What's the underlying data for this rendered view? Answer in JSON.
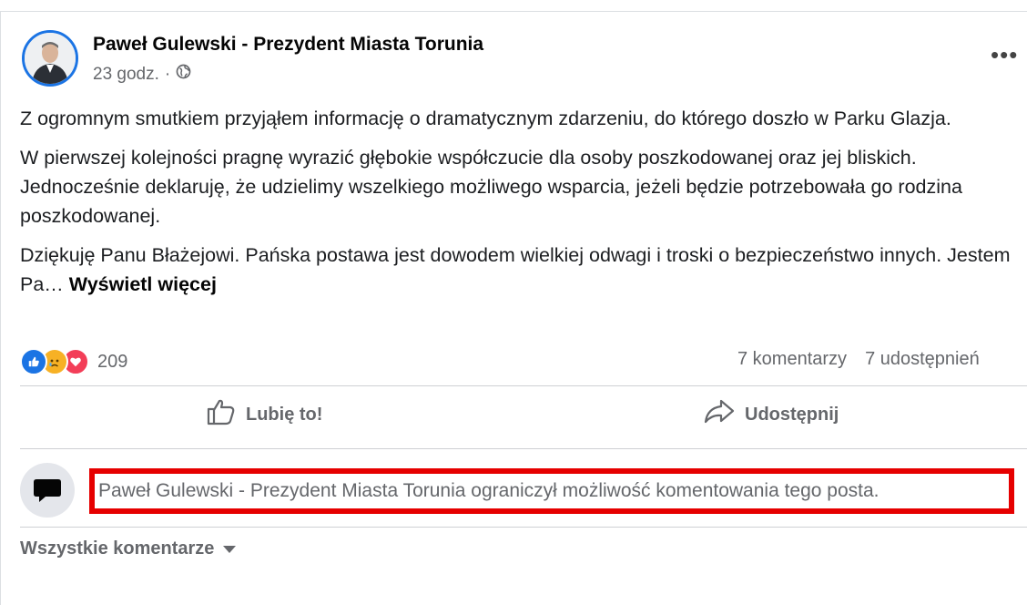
{
  "post": {
    "author": "Paweł Gulewski - Prezydent Miasta Torunia",
    "time": "23 godz.",
    "separator": "·",
    "paragraphs": [
      "Z ogromnym smutkiem przyjąłem informację o dramatycznym zdarzeniu, do którego doszło w Parku Glazja.",
      "W pierwszej kolejności pragnę wyrazić głębokie współczucie dla osoby poszkodowanej oraz jej bliskich. Jednocześnie deklaruję, że udzielimy wszelkiego możliwego wsparcia, jeżeli będzie potrzebowała go rodzina poszkodowanej.",
      "Dziękuję Panu Błażejowi. Pańska postawa jest dowodem wielkiej odwagi i troski o bezpieczeństwo innych. Jestem Pa…"
    ],
    "see_more": "Wyświetl więcej"
  },
  "engagement": {
    "reaction_count": "209",
    "comments": "7 komentarzy",
    "shares": "7 udostępnień"
  },
  "actions": {
    "like": "Lubię to!",
    "share": "Udostępnij"
  },
  "comments": {
    "restricted_notice": "Paweł Gulewski - Prezydent Miasta Torunia ograniczył możliwość komentowania tego posta.",
    "filter_label": "Wszystkie komentarze"
  },
  "colors": {
    "like_blue": "#1b74e4",
    "love_red": "#f33e58",
    "sad_yellow": "#f7b125",
    "highlight_red": "#e60000"
  }
}
